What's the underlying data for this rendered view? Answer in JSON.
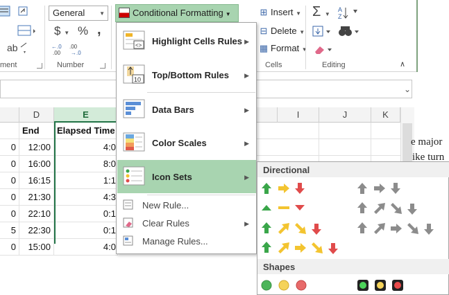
{
  "ribbon": {
    "number_format": "General",
    "currency_symbol": "$",
    "percent_symbol": "%",
    "comma_symbol": ",",
    "conditional_formatting_label": "Conditional Formatting",
    "insert_label": "Insert",
    "delete_label": "Delete",
    "format_label": "Format",
    "group_labels": {
      "alignment": "ment",
      "number": "Number",
      "cells": "Cells",
      "editing": "Editing"
    }
  },
  "sheet": {
    "columns": {
      "D": "D",
      "E": "E",
      "I": "I",
      "J": "J",
      "K": "K"
    },
    "headers": {
      "end": "End",
      "elapsed": "Elapsed Time"
    },
    "rows": [
      {
        "left": "0",
        "end": "12:00",
        "elapsed": "4:0"
      },
      {
        "left": "0",
        "end": "16:00",
        "elapsed": "8:0"
      },
      {
        "left": "0",
        "end": "16:15",
        "elapsed": "1:1"
      },
      {
        "left": "0",
        "end": "21:30",
        "elapsed": "4:3"
      },
      {
        "left": "0",
        "end": "22:10",
        "elapsed": "0:1"
      },
      {
        "left": "5",
        "end": "22:30",
        "elapsed": "0:1"
      },
      {
        "left": "0",
        "end": "15:00",
        "elapsed": "4:0"
      }
    ],
    "doc_text": [
      "e major",
      "ike turn"
    ]
  },
  "menu": {
    "items": [
      {
        "label": "Highlight Cells Rules",
        "has_submenu": true
      },
      {
        "label": "Top/Bottom Rules",
        "has_submenu": true
      },
      {
        "label": "Data Bars",
        "has_submenu": true
      },
      {
        "label": "Color Scales",
        "has_submenu": true
      },
      {
        "label": "Icon Sets",
        "has_submenu": true,
        "active": true
      }
    ],
    "small_items": [
      {
        "label": "New Rule..."
      },
      {
        "label": "Clear Rules",
        "has_submenu": true
      },
      {
        "label": "Manage Rules..."
      }
    ],
    "topbottom_icon_text": "10"
  },
  "submenu": {
    "directional_label": "Directional",
    "shapes_label": "Shapes"
  },
  "colors": {
    "accent_green": "#217346",
    "menu_highlight": "#a8d4b0",
    "arrow_green": "#3aa64a",
    "arrow_yellow": "#f3c430",
    "arrow_red": "#e04b4b",
    "arrow_gray": "#8c8c8c"
  }
}
